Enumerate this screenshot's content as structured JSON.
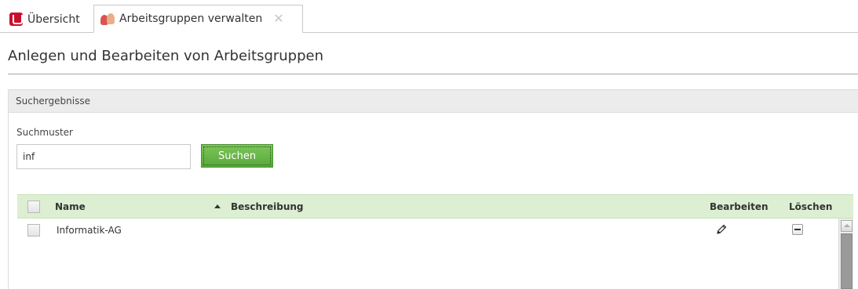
{
  "tabs": [
    {
      "label": "Übersicht",
      "icon": "school-logo-icon",
      "active": false
    },
    {
      "label": "Arbeitsgruppen verwalten",
      "icon": "group-icon",
      "active": true,
      "closable": true
    }
  ],
  "page": {
    "title": "Anlegen und Bearbeiten von Arbeitsgruppen"
  },
  "panel": {
    "title": "Suchergebnisse",
    "search": {
      "label": "Suchmuster",
      "value": "inf",
      "button_label": "Suchen"
    }
  },
  "table": {
    "columns": {
      "name": "Name",
      "description": "Beschreibung",
      "edit": "Bearbeiten",
      "delete": "Löschen"
    },
    "sort": {
      "column": "name",
      "direction": "ascending"
    },
    "rows": [
      {
        "name": "Informatik-AG",
        "description": ""
      }
    ]
  },
  "colors": {
    "accent_green": "#58a83a",
    "table_header_bg": "#dcefd2",
    "logo_red": "#c8102e"
  }
}
